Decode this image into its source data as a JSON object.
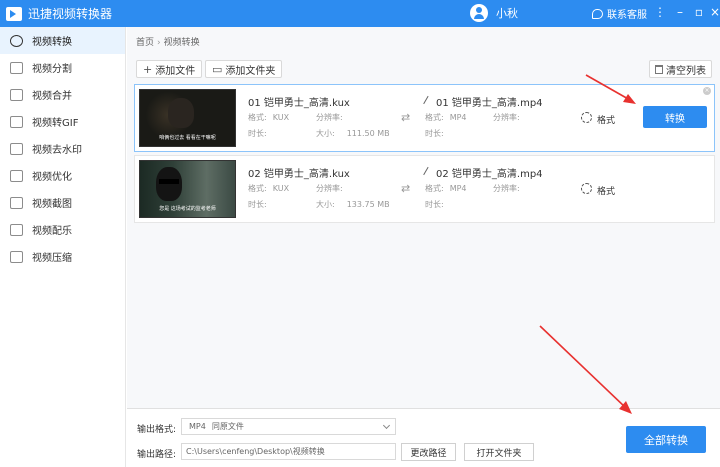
{
  "app": {
    "title": "迅捷视频转换器"
  },
  "header": {
    "username": "小秋",
    "support": "联系客服"
  },
  "sidebar": {
    "items": [
      {
        "label": "视频转换",
        "icon": "video-convert-icon"
      },
      {
        "label": "视频分割",
        "icon": "video-split-icon"
      },
      {
        "label": "视频合并",
        "icon": "video-merge-icon"
      },
      {
        "label": "视频转GIF",
        "icon": "gif-icon"
      },
      {
        "label": "视频去水印",
        "icon": "watermark-icon"
      },
      {
        "label": "视频优化",
        "icon": "optimize-icon"
      },
      {
        "label": "视频截图",
        "icon": "screenshot-icon"
      },
      {
        "label": "视频配乐",
        "icon": "music-icon"
      },
      {
        "label": "视频压缩",
        "icon": "compress-icon"
      }
    ]
  },
  "breadcrumb": {
    "home": "首页",
    "current": "视频转换"
  },
  "toolbar": {
    "add_file": "添加文件",
    "add_folder": "添加文件夹",
    "clear_list": "清空列表"
  },
  "files": [
    {
      "source_name": "01 铠甲勇士_高清.kux",
      "format_label": "格式:",
      "format": "KUX",
      "resolution_label": "分辨率:",
      "resolution": "",
      "duration_label": "时长:",
      "duration": "",
      "size_label": "大小:",
      "size": "111.50 MB",
      "output_name": "01 铠甲勇士_高清.mp4",
      "out_format": "MP4",
      "settings_label": "格式",
      "convert_label": "转换",
      "subtitle": "咱俩也过去 看看在干嘛呢"
    },
    {
      "source_name": "02 铠甲勇士_高清.kux",
      "format_label": "格式:",
      "format": "KUX",
      "resolution_label": "分辨率:",
      "resolution": "",
      "duration_label": "时长:",
      "duration": "",
      "size_label": "大小:",
      "size": "133.75 MB",
      "output_name": "02 铠甲勇士_高清.mp4",
      "out_format": "MP4",
      "settings_label": "格式",
      "subtitle": "您是 这场考试的监考老师"
    }
  ],
  "bottom": {
    "format_label": "输出格式:",
    "format_value": "MP4",
    "format_sub": "同原文件",
    "path_label": "输出路径:",
    "path_value": "C:\\Users\\cenfeng\\Desktop\\视频转换",
    "change_path": "更改路径",
    "open_folder": "打开文件夹",
    "convert_all": "全部转换"
  },
  "colors": {
    "accent": "#2d8cf0",
    "annotation": "#e8312f"
  }
}
